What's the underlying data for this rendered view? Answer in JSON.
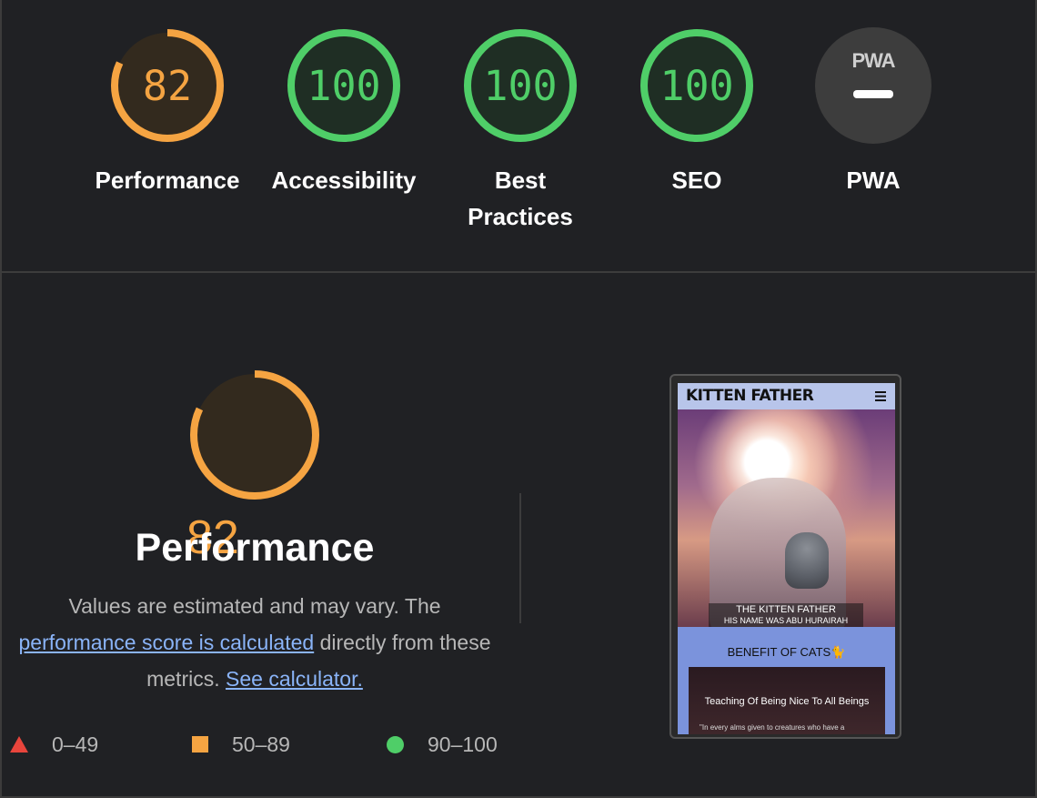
{
  "categories": [
    {
      "score": "82",
      "label": "Performance",
      "ratio": 0.82,
      "color": "#f5a442",
      "fill": "#332a1e"
    },
    {
      "score": "100",
      "label": "Accessibility",
      "ratio": 1.0,
      "color": "#4fce68",
      "fill": "#1f2e24"
    },
    {
      "score": "100",
      "label_line1": "Best",
      "label_line2": "Practices",
      "ratio": 1.0,
      "color": "#4fce68",
      "fill": "#1f2e24"
    },
    {
      "score": "100",
      "label": "SEO",
      "ratio": 1.0,
      "color": "#4fce68",
      "fill": "#1f2e24"
    },
    {
      "badge": "PWA",
      "label": "PWA",
      "fill": "#3d3d3d"
    }
  ],
  "performance": {
    "score": "82",
    "ratio": 0.82,
    "title": "Performance",
    "desc_part1": "Values are estimated and may vary. The ",
    "desc_link": "performance score is calculated",
    "desc_part2": " directly from these metrics. ",
    "calc_link": "See calculator."
  },
  "legend": [
    {
      "range": "0–49",
      "shape": "triangle",
      "color": "#e8453c"
    },
    {
      "range": "50–89",
      "shape": "square",
      "color": "#f5a442"
    },
    {
      "range": "90–100",
      "shape": "circle",
      "color": "#4fce68"
    }
  ],
  "screenshot": {
    "brand": "KITTEN FATHER",
    "caption_title": "THE KITTEN FATHER",
    "caption_sub": "HIS NAME WAS ABU HURAIRAH",
    "section_title": "BENEFIT OF CATS🐈",
    "card_title": "Teaching Of Being Nice To All Beings",
    "card_text": "\"In every alms given to creatures who have a"
  }
}
